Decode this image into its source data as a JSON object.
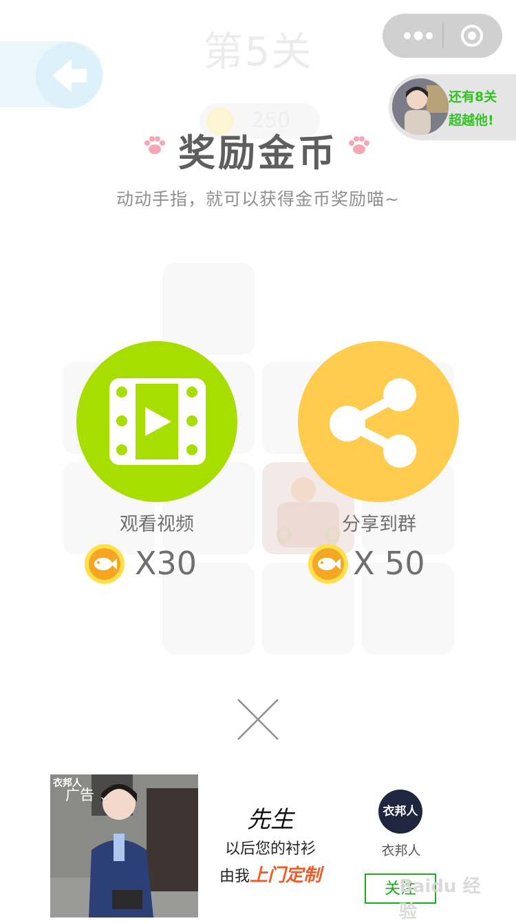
{
  "game": {
    "level_title": "第5关",
    "coins": "250"
  },
  "capsule": {
    "more_icon": "more-dots-icon",
    "close_icon": "target-close-icon"
  },
  "friend": {
    "line1": "还有8关",
    "line2": "超越他!"
  },
  "reward": {
    "title": "奖励金币",
    "subtitle": "动动手指，就可以获得金币奖励喵~",
    "options": [
      {
        "label": "观看视频",
        "amount": "X30",
        "icon": "video-film-icon",
        "color": "#a8dd00"
      },
      {
        "label": "分享到群",
        "amount": "X 50",
        "icon": "share-icon",
        "color": "#ffcc4d"
      }
    ],
    "coin_icon": "fish-coin-icon"
  },
  "ad": {
    "tag": "广告",
    "image_brand": "衣邦人",
    "headline": "先生",
    "line1": "以后您的衬衫",
    "line2_prefix": "由我",
    "line2_highlight": "上门定制",
    "logo_text": "衣邦人",
    "name": "衣邦人",
    "follow": "关注"
  },
  "watermark": "Baidu 经验"
}
